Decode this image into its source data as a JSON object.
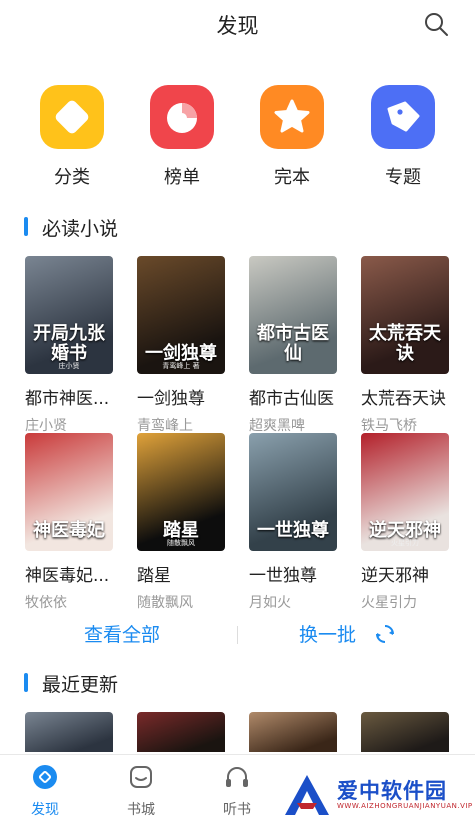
{
  "header": {
    "title": "发现"
  },
  "categories": [
    {
      "label": "分类",
      "icon": "category-icon",
      "color": "#ffc21a"
    },
    {
      "label": "榜单",
      "icon": "ranking-icon",
      "color": "#f0454b"
    },
    {
      "label": "完本",
      "icon": "complete-star-icon",
      "color": "#ff8a23"
    },
    {
      "label": "专题",
      "icon": "topic-tag-icon",
      "color": "#4d6ff5"
    }
  ],
  "must_read": {
    "title": "必读小说",
    "books": [
      {
        "title": "都市神医...",
        "author": "庄小贤",
        "cover_text": "开局九张婚书",
        "cover_sub": "庄小贤",
        "colors": [
          "#2c3440",
          "#7a8592"
        ]
      },
      {
        "title": "一剑独尊",
        "author": "青鸾峰上",
        "cover_text": "一剑独尊",
        "cover_sub": "青鸾峰上 著",
        "colors": [
          "#1a1410",
          "#6a4a2a"
        ]
      },
      {
        "title": "都市古仙医",
        "author": "超爽黑啤",
        "cover_text": "都市古医仙",
        "cover_sub": "",
        "colors": [
          "#5d6a6f",
          "#c9c9c2"
        ]
      },
      {
        "title": "太荒吞天诀",
        "author": "铁马飞桥",
        "cover_text": "太荒吞天诀",
        "cover_sub": "",
        "colors": [
          "#2b1a18",
          "#8a5a4a"
        ]
      },
      {
        "title": "神医毒妃...",
        "author": "牧依依",
        "cover_text": "神医毒妃",
        "cover_sub": "",
        "colors": [
          "#f2e6e0",
          "#c93a3a"
        ]
      },
      {
        "title": "踏星",
        "author": "随散飘风",
        "cover_text": "踏星",
        "cover_sub": "随散飘风",
        "colors": [
          "#0d0d0d",
          "#e0a23a"
        ]
      },
      {
        "title": "一世独尊",
        "author": "月如火",
        "cover_text": "一世独尊",
        "cover_sub": "",
        "colors": [
          "#33414a",
          "#8aa0ad"
        ]
      },
      {
        "title": "逆天邪神",
        "author": "火星引力",
        "cover_text": "逆天邪神",
        "cover_sub": "火星引力",
        "colors": [
          "#e9e2df",
          "#b3202a"
        ]
      }
    ]
  },
  "actions": {
    "view_all": "查看全部",
    "refresh": "换一批"
  },
  "recent": {
    "title": "最近更新",
    "covers": [
      {
        "colors": [
          "#2c3440",
          "#7a8592"
        ]
      },
      {
        "colors": [
          "#1a1410",
          "#7a2a2a"
        ]
      },
      {
        "colors": [
          "#3a2618",
          "#b08a6a"
        ]
      },
      {
        "colors": [
          "#1e1a18",
          "#6a5a40"
        ]
      }
    ]
  },
  "tabs": [
    {
      "label": "发现",
      "icon": "discover-icon",
      "active": true
    },
    {
      "label": "书城",
      "icon": "bookstore-icon",
      "active": false
    },
    {
      "label": "听书",
      "icon": "headphones-icon",
      "active": false
    }
  ],
  "watermark": {
    "text": "爱中软件园",
    "url": "WWW.AIZHONGRUANJIANYUAN.VIP"
  },
  "theme": {
    "accent": "#1b8bf0"
  }
}
